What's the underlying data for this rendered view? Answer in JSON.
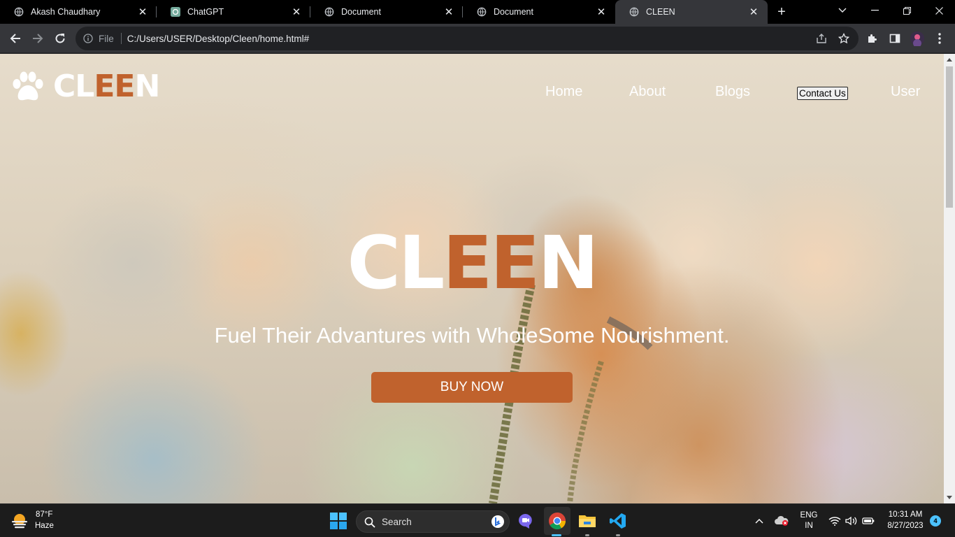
{
  "browser": {
    "tabs": [
      {
        "title": "Akash Chaudhary",
        "active": false
      },
      {
        "title": "ChatGPT",
        "active": false
      },
      {
        "title": "Document",
        "active": false
      },
      {
        "title": "Document",
        "active": false
      },
      {
        "title": "CLEEN",
        "active": true
      }
    ],
    "address": {
      "scheme_label": "File",
      "url": "C:/Users/USER/Desktop/Cleen/home.html#"
    }
  },
  "page": {
    "logo": {
      "part1": "CL",
      "part2": "EE",
      "part3": "N"
    },
    "nav": {
      "home": "Home",
      "about": "About",
      "blogs": "Blogs",
      "contact": "Contact Us",
      "user": "User"
    },
    "hero": {
      "title_part1": "CL",
      "title_part2": "EE",
      "title_part3": "N",
      "tagline": "Fuel Their Advantures with WholeSome Nourishment.",
      "cta": "BUY NOW"
    },
    "colors": {
      "brand": "#c0622d",
      "text": "#ffffff"
    }
  },
  "taskbar": {
    "weather": {
      "temp": "87°F",
      "condition": "Haze"
    },
    "search_label": "Search",
    "language": {
      "line1": "ENG",
      "line2": "IN"
    },
    "clock": {
      "time": "10:31 AM",
      "date": "8/27/2023"
    },
    "notification_count": "4"
  }
}
